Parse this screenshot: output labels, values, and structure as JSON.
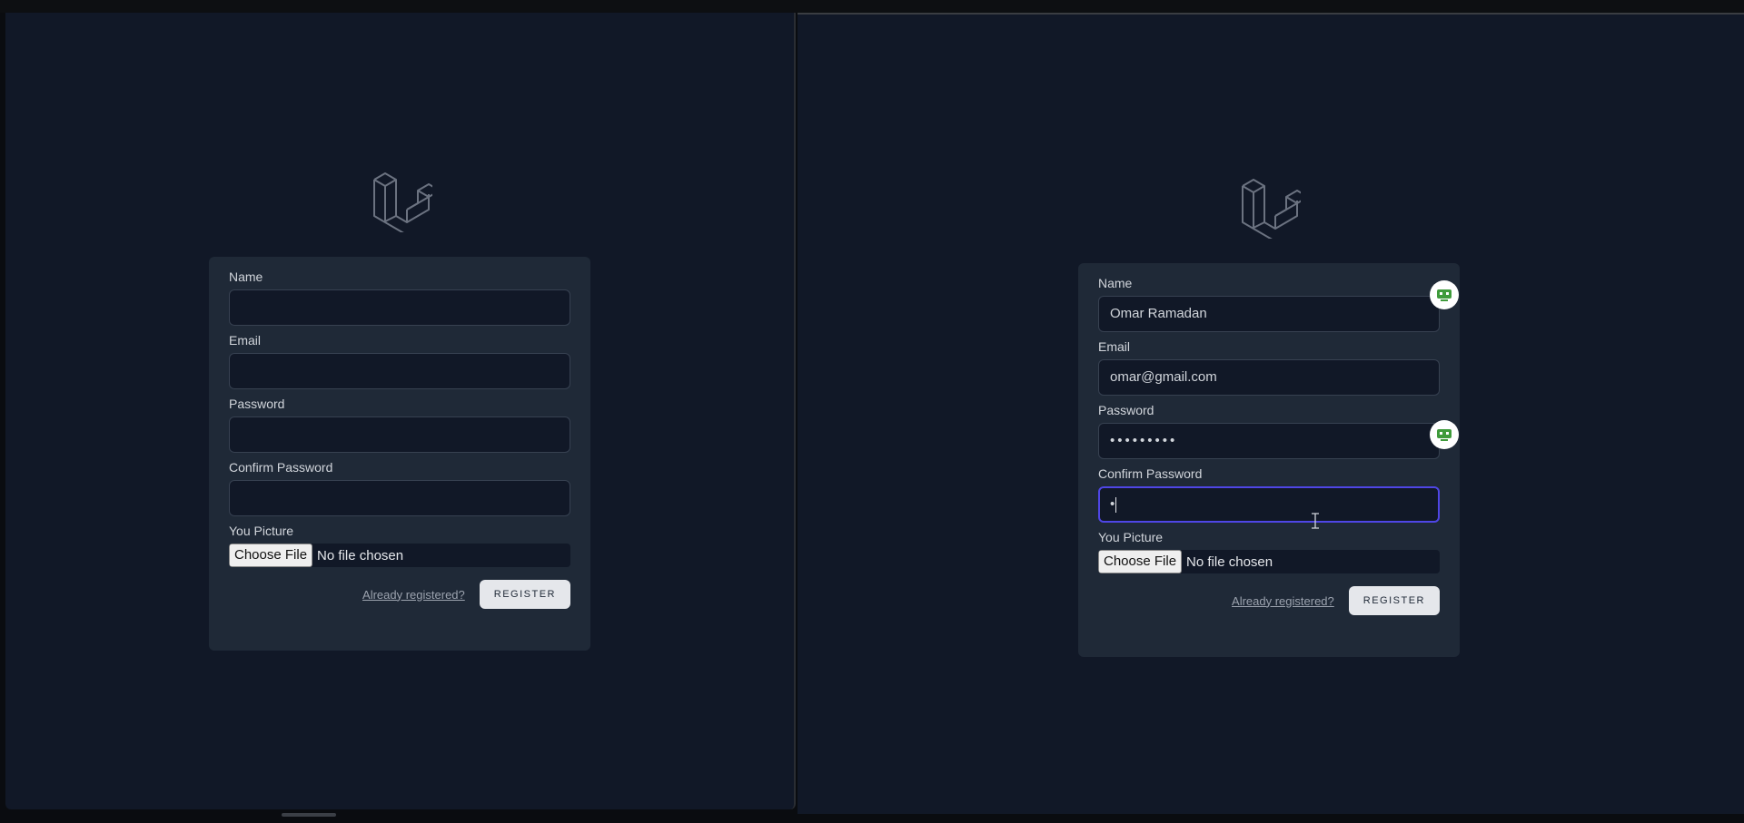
{
  "left_window": {
    "form": {
      "name_label": "Name",
      "name_value": "",
      "email_label": "Email",
      "email_value": "",
      "password_label": "Password",
      "password_value": "",
      "confirm_label": "Confirm Password",
      "confirm_value": "",
      "picture_label": "You Picture",
      "file_button": "Choose File",
      "file_status": "No file chosen",
      "login_link": "Already registered?",
      "register_button": "REGISTER"
    }
  },
  "right_window": {
    "form": {
      "name_label": "Name",
      "name_value": "Omar Ramadan",
      "email_label": "Email",
      "email_value": "omar@gmail.com",
      "password_label": "Password",
      "password_value": "•••••••••",
      "confirm_label": "Confirm Password",
      "confirm_value": "•",
      "picture_label": "You Picture",
      "file_button": "Choose File",
      "file_status": "No file chosen",
      "login_link": "Already registered?",
      "register_button": "REGISTER"
    }
  },
  "icons": {
    "logo": "laravel-logo-icon",
    "extension_badge": "password-manager-icon",
    "cursor": "text-cursor-icon"
  },
  "colors": {
    "page_bg": "#111827",
    "card_bg": "#1f2937",
    "input_bg": "#111827",
    "focus_ring": "#4f46e5",
    "button_bg": "#e5e7eb",
    "badge_green": "#3f9b3b"
  }
}
